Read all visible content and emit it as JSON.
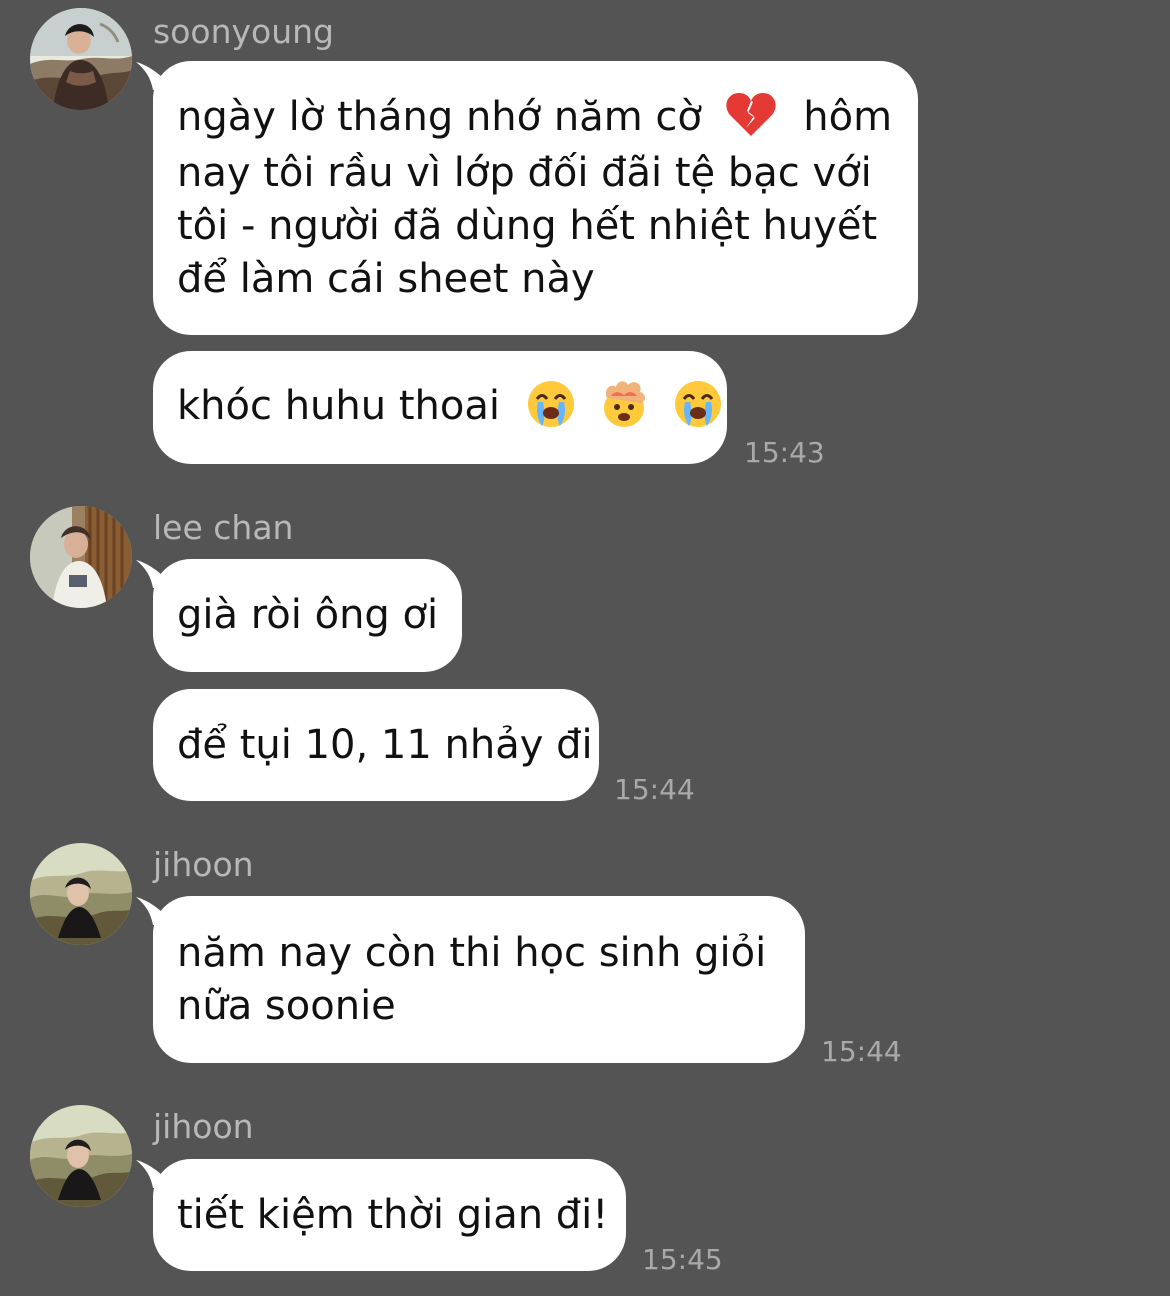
{
  "messages": [
    {
      "sender": "soonyoung",
      "bubbles": [
        {
          "lines": [
            "ngày lờ tháng nhớ năm cờ",
            "nay tôi rầu vì lớp đối đãi tệ bạc với",
            "tôi - người đã dùng hết nhiệt huyết",
            "để làm cái sheet này"
          ],
          "line1_after": "hôm",
          "emoji": "broken-heart"
        },
        {
          "text": "khóc huhu thoai",
          "emojis": [
            "loudly-crying-face",
            "exploding-head",
            "loudly-crying-face"
          ]
        }
      ],
      "time": "15:43"
    },
    {
      "sender": "lee chan",
      "bubbles": [
        {
          "text": "già ròi ông ơi"
        },
        {
          "text": "để tụi 10, 11 nhảy đi"
        }
      ],
      "time": "15:44"
    },
    {
      "sender": "jihoon",
      "bubbles": [
        {
          "lines": [
            "năm nay còn thi học sinh giỏi",
            "nữa soonie"
          ]
        }
      ],
      "time": "15:44"
    },
    {
      "sender": "jihoon",
      "bubbles": [
        {
          "text": "tiết kiệm thời gian đi!"
        }
      ],
      "time": "15:45"
    }
  ],
  "colors": {
    "background": "#545454",
    "bubble": "#ffffff",
    "sender_text": "#b8b8b8",
    "time_text": "#a9a9a9",
    "message_text": "#111111"
  }
}
